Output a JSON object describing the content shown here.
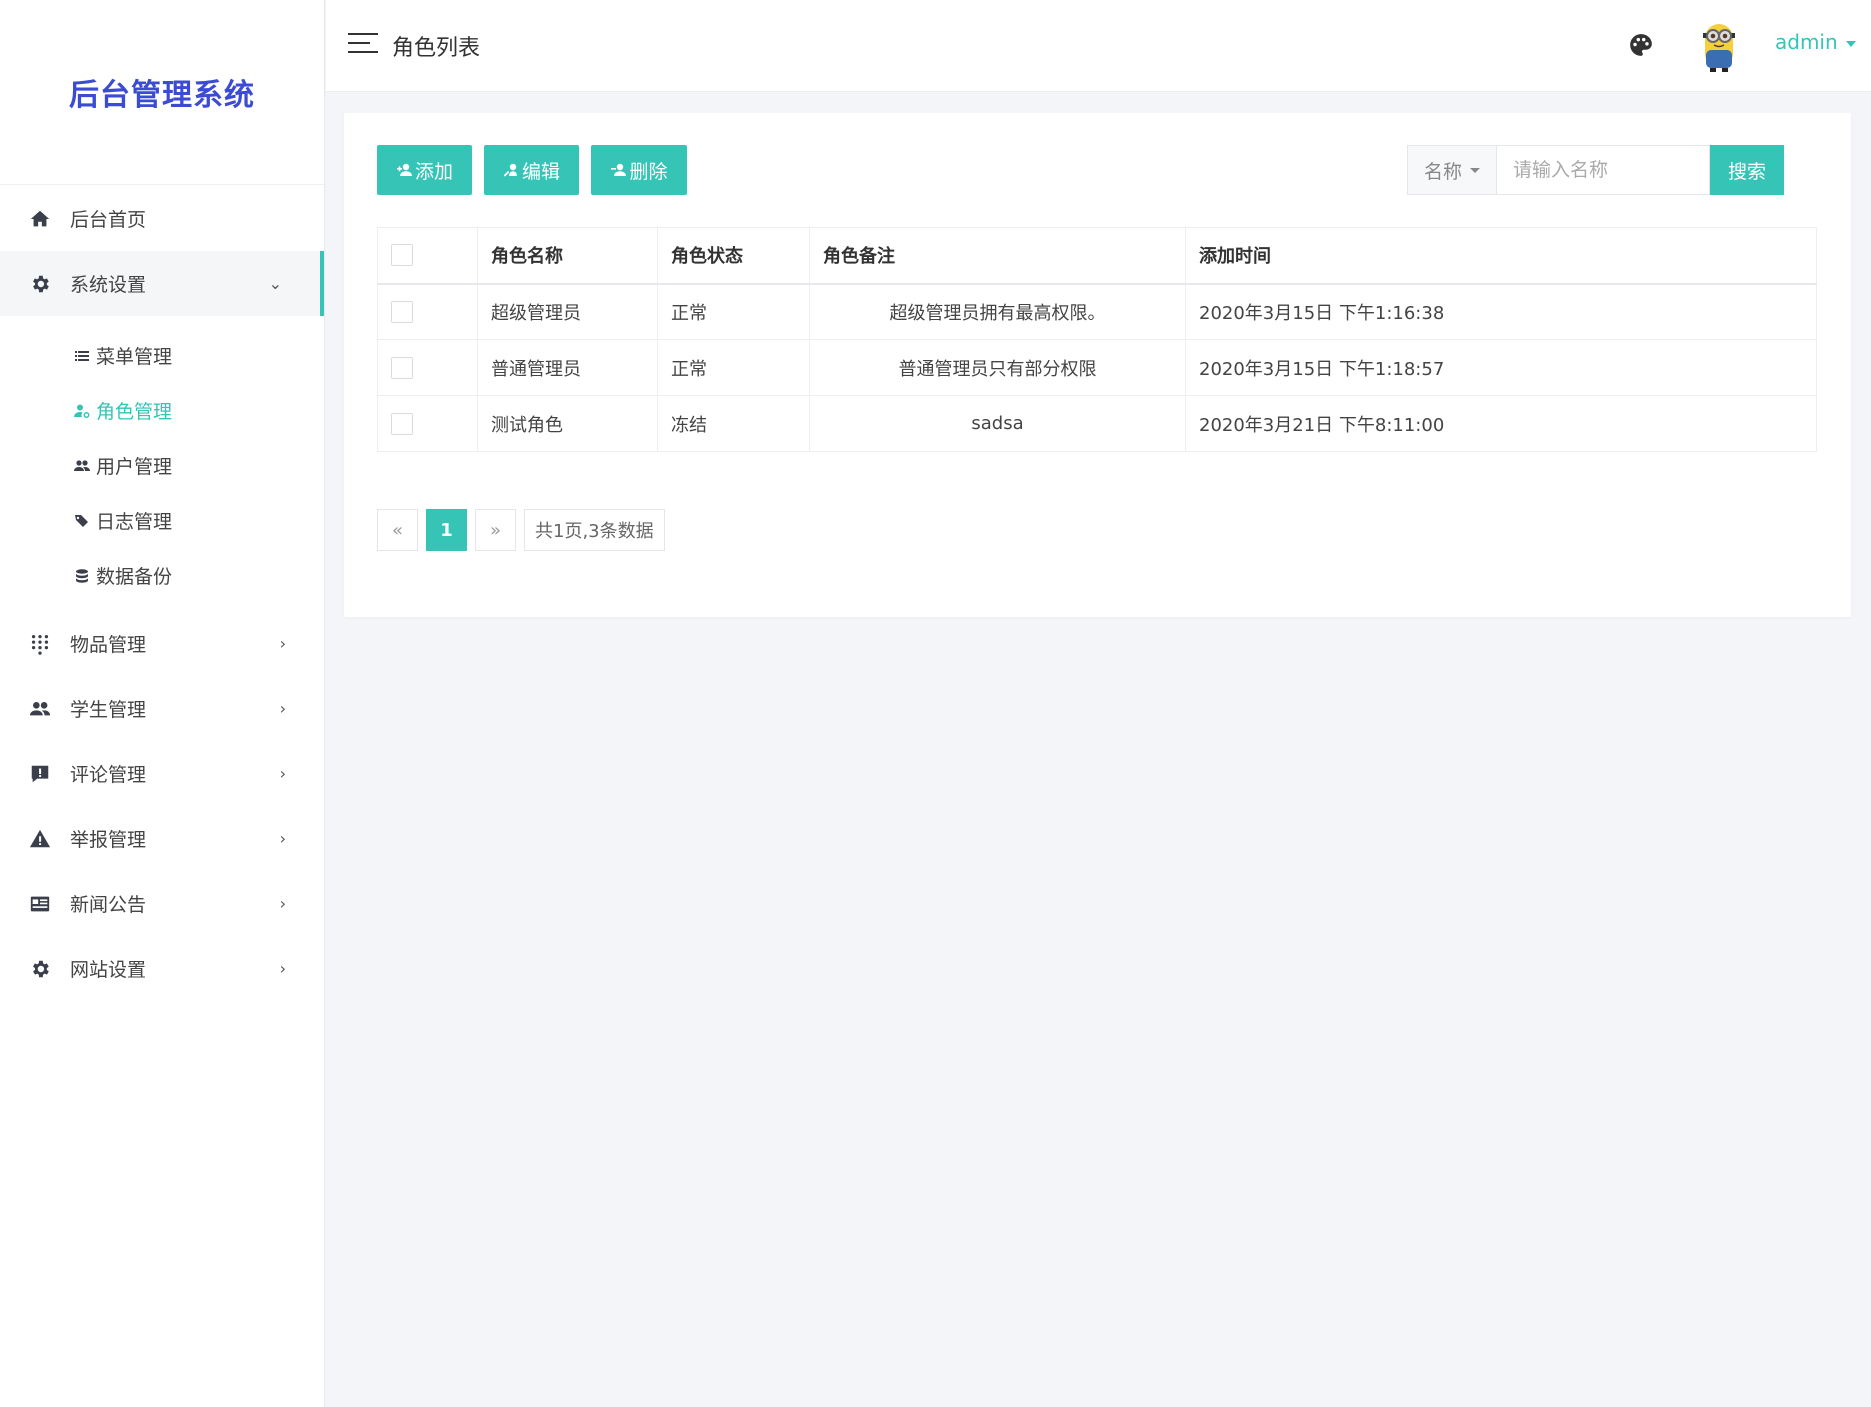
{
  "brand": {
    "title": "后台管理系统",
    "color": "#3c4bd4"
  },
  "accent_color": "#35c4b6",
  "sidebar": {
    "items": [
      {
        "label": "后台首页",
        "icon": "home-icon",
        "has_children": false
      },
      {
        "label": "系统设置",
        "icon": "gear-icon",
        "has_children": true,
        "expanded": true,
        "children": [
          {
            "label": "菜单管理",
            "icon": "list-icon",
            "active": false
          },
          {
            "label": "角色管理",
            "icon": "user-gear-icon",
            "active": true
          },
          {
            "label": "用户管理",
            "icon": "users-icon",
            "active": false
          },
          {
            "label": "日志管理",
            "icon": "tags-icon",
            "active": false
          },
          {
            "label": "数据备份",
            "icon": "database-icon",
            "active": false
          }
        ]
      },
      {
        "label": "物品管理",
        "icon": "grid-dots-icon",
        "has_children": true
      },
      {
        "label": "学生管理",
        "icon": "users-icon",
        "has_children": true
      },
      {
        "label": "评论管理",
        "icon": "comment-icon",
        "has_children": true
      },
      {
        "label": "举报管理",
        "icon": "warning-icon",
        "has_children": true
      },
      {
        "label": "新闻公告",
        "icon": "news-icon",
        "has_children": true
      },
      {
        "label": "网站设置",
        "icon": "gear-icon",
        "has_children": true
      }
    ]
  },
  "header": {
    "page_title": "角色列表",
    "username": "admin"
  },
  "toolbar": {
    "add_label": "添加",
    "edit_label": "编辑",
    "delete_label": "删除",
    "search_type": "名称",
    "search_placeholder": "请输入名称",
    "search_value": "",
    "search_label": "搜索"
  },
  "table": {
    "columns": [
      "角色名称",
      "角色状态",
      "角色备注",
      "添加时间"
    ],
    "rows": [
      {
        "name": "超级管理员",
        "status": "正常",
        "status_kind": "ok",
        "remark": "超级管理员拥有最高权限。",
        "time": "2020年3月15日 下午1:16:38"
      },
      {
        "name": "普通管理员",
        "status": "正常",
        "status_kind": "ok",
        "remark": "普通管理员只有部分权限",
        "time": "2020年3月15日 下午1:18:57"
      },
      {
        "name": "测试角色",
        "status": "冻结",
        "status_kind": "frozen",
        "remark": "sadsa",
        "time": "2020年3月21日 下午8:11:00"
      }
    ]
  },
  "pagination": {
    "prev": "«",
    "current": "1",
    "next": "»",
    "summary": "共1页,3条数据"
  }
}
